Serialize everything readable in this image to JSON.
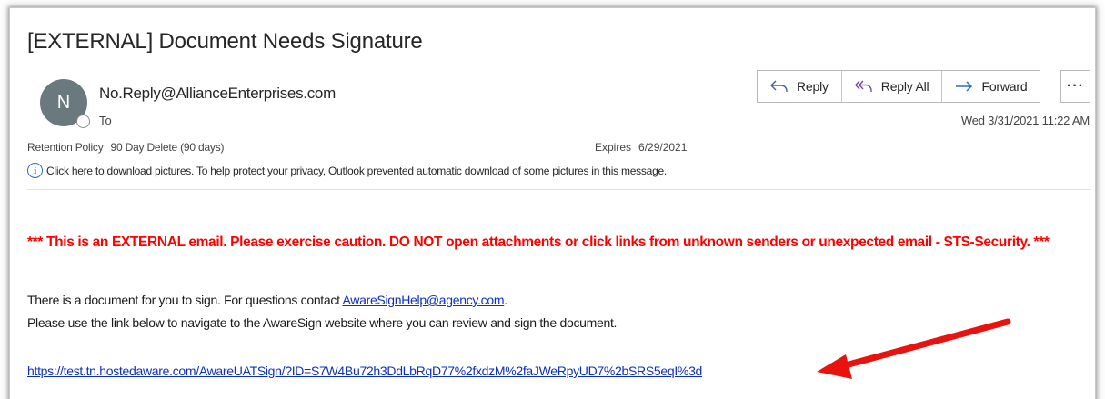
{
  "message": {
    "subject": "[EXTERNAL] Document Needs Signature",
    "avatar_initial": "N",
    "sender": "No.Reply@AllianceEnterprises.com",
    "to_label": "To",
    "datetime": "Wed 3/31/2021 11:22 AM",
    "retention_label": "Retention Policy",
    "retention_value": "90 Day Delete (90 days)",
    "expires_label": "Expires",
    "expires_value": "6/29/2021",
    "info_text": "Click here to download pictures. To help protect your privacy, Outlook prevented automatic download of some pictures in this message."
  },
  "actions": {
    "reply": "Reply",
    "reply_all": "Reply All",
    "forward": "Forward",
    "more": "···"
  },
  "body": {
    "warning": "*** This is an EXTERNAL email. Please exercise caution. DO NOT open attachments or click links from unknown senders or unexpected email - STS-Security. ***",
    "line1_prefix": "There is a document for you to sign. For questions contact ",
    "help_email": "AwareSignHelp@agency.com",
    "line1_suffix": ".",
    "line2": "Please use the link below to navigate to the AwareSign website where you can review and sign the document.",
    "sign_url": "https://test.tn.hostedaware.com/AwareUATSign/?ID=S7W4Bu72h3DdLbRqD77%2fxdzM%2faJWeRpyUD7%2bSRS5eqI%3d"
  },
  "colors": {
    "warning": "#ff0000",
    "link": "#0b2fc4",
    "accent": "#2b6cc4",
    "annotation_arrow": "#e8130f"
  },
  "icons": {
    "reply": "reply-arrow-icon",
    "reply_all": "reply-all-arrow-icon",
    "forward": "forward-arrow-icon",
    "info": "info-circle-icon",
    "annotation": "red-pointer-arrow"
  }
}
